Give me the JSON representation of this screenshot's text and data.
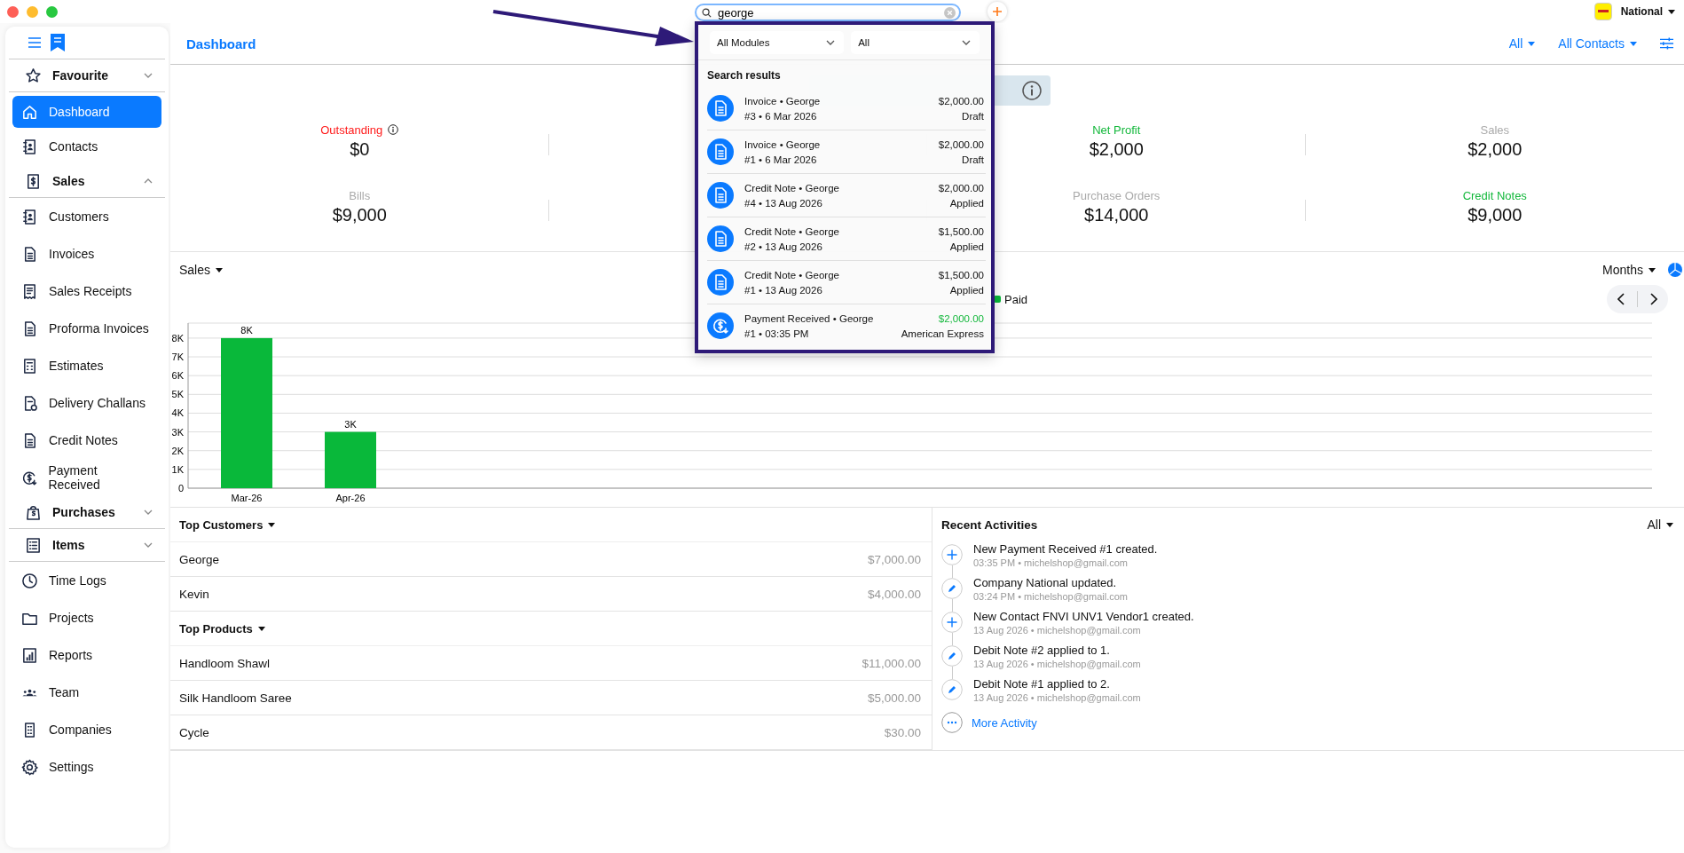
{
  "search": {
    "value": "george"
  },
  "company": {
    "name": "National"
  },
  "sidebar": {
    "items": [
      {
        "kind": "section",
        "label": "Favourite",
        "expanded": false
      },
      {
        "kind": "link",
        "label": "Dashboard",
        "selected": true
      },
      {
        "kind": "link",
        "label": "Contacts",
        "selected": false
      },
      {
        "kind": "section",
        "label": "Sales",
        "expanded": true
      },
      {
        "kind": "link",
        "label": "Customers",
        "selected": false
      },
      {
        "kind": "link",
        "label": "Invoices",
        "selected": false
      },
      {
        "kind": "link",
        "label": "Sales Receipts",
        "selected": false
      },
      {
        "kind": "link",
        "label": "Proforma Invoices",
        "selected": false
      },
      {
        "kind": "link",
        "label": "Estimates",
        "selected": false
      },
      {
        "kind": "link",
        "label": "Delivery Challans",
        "selected": false
      },
      {
        "kind": "link",
        "label": "Credit Notes",
        "selected": false
      },
      {
        "kind": "link",
        "label": "Payment Received",
        "selected": false
      },
      {
        "kind": "section",
        "label": "Purchases",
        "expanded": false
      },
      {
        "kind": "section",
        "label": "Items",
        "expanded": false
      },
      {
        "kind": "link",
        "label": "Time Logs",
        "selected": false
      },
      {
        "kind": "link",
        "label": "Projects",
        "selected": false
      },
      {
        "kind": "link",
        "label": "Reports",
        "selected": false
      },
      {
        "kind": "link",
        "label": "Team",
        "selected": false
      },
      {
        "kind": "link",
        "label": "Companies",
        "selected": false
      },
      {
        "kind": "link",
        "label": "Settings",
        "selected": false
      }
    ]
  },
  "header": {
    "title": "Dashboard",
    "filters": [
      "All",
      "All Contacts"
    ]
  },
  "stats": [
    {
      "label": "Outstanding",
      "value": "$0",
      "color": "#ff1a1a",
      "info": true
    },
    {
      "label": "Net Profit",
      "value": "$2,000",
      "color": "#14b83c"
    },
    {
      "label": "Sales",
      "value": "$2,000",
      "color": "#aaaaaa"
    },
    {
      "label": "Bills",
      "value": "$9,000",
      "color": "#aaaaaa"
    },
    {
      "label": "Purchase Orders",
      "value": "$14,000",
      "color": "#aaaaaa"
    },
    {
      "label": "Credit Notes",
      "value": "$9,000",
      "color": "#14b83c"
    }
  ],
  "sales_chart": {
    "title": "Sales",
    "period": "Months",
    "chart_data": {
      "type": "bar",
      "grid": true,
      "categories": [
        "Mar-26",
        "Apr-26"
      ],
      "series": [
        {
          "name": "Paid",
          "color": "#09b83a",
          "values": [
            8000,
            3000
          ]
        }
      ],
      "ylim": [
        0,
        8800
      ],
      "yticks": [
        {
          "value": 0,
          "label": "0"
        },
        {
          "value": 1000,
          "label": "1K"
        },
        {
          "value": 2000,
          "label": "2K"
        },
        {
          "value": 3000,
          "label": "3K"
        },
        {
          "value": 4000,
          "label": "4K"
        },
        {
          "value": 5000,
          "label": "5K"
        },
        {
          "value": 6000,
          "label": "6K"
        },
        {
          "value": 7000,
          "label": "7K"
        },
        {
          "value": 8000,
          "label": "8K"
        }
      ],
      "value_labels": [
        "8K",
        "3K"
      ]
    }
  },
  "top_customers": {
    "title": "Top Customers",
    "rows": [
      {
        "name": "George",
        "amount": "$7,000.00"
      },
      {
        "name": "Kevin",
        "amount": "$4,000.00"
      }
    ]
  },
  "top_products": {
    "title": "Top Products",
    "rows": [
      {
        "name": "Handloom Shawl",
        "amount": "$11,000.00"
      },
      {
        "name": "Silk Handloom Saree",
        "amount": "$5,000.00"
      },
      {
        "name": "Cycle",
        "amount": "$30.00"
      }
    ]
  },
  "recent_activities": {
    "title": "Recent Activities",
    "filter": "All",
    "more": "More Activity",
    "items": [
      {
        "kind": "create",
        "text": "New Payment Received #1 created.",
        "meta": "03:35 PM • michelshop@gmail.com"
      },
      {
        "kind": "edit",
        "text": "Company National updated.",
        "meta": "03:24 PM • michelshop@gmail.com"
      },
      {
        "kind": "create",
        "text": "New Contact FNVI UNV1 Vendor1 created.",
        "meta": "13 Aug 2026 • michelshop@gmail.com"
      },
      {
        "kind": "edit",
        "text": "Debit Note #2 applied to 1.",
        "meta": "13 Aug 2026 • michelshop@gmail.com"
      },
      {
        "kind": "edit",
        "text": "Debit Note #1 applied to 2.",
        "meta": "13 Aug 2026 • michelshop@gmail.com"
      }
    ]
  },
  "search_results": {
    "filters": [
      "All Modules",
      "All"
    ],
    "heading": "Search results",
    "results": [
      {
        "kind": "invoice",
        "title": "Invoice • George",
        "subtitle": "#3 • 6 Mar 2026",
        "amount": "$2,000.00",
        "status": "Draft"
      },
      {
        "kind": "invoice",
        "title": "Invoice • George",
        "subtitle": "#1 • 6 Mar 2026",
        "amount": "$2,000.00",
        "status": "Draft"
      },
      {
        "kind": "credit",
        "title": "Credit Note • George",
        "subtitle": "#4 • 13 Aug 2026",
        "amount": "$2,000.00",
        "status": "Applied"
      },
      {
        "kind": "credit",
        "title": "Credit Note • George",
        "subtitle": "#2 • 13 Aug 2026",
        "amount": "$1,500.00",
        "status": "Applied"
      },
      {
        "kind": "credit",
        "title": "Credit Note • George",
        "subtitle": "#1 • 13 Aug 2026",
        "amount": "$1,500.00",
        "status": "Applied"
      },
      {
        "kind": "payment",
        "title": "Payment Received • George",
        "subtitle": "#1 • 03:35 PM",
        "amount": "$2,000.00",
        "status": "American Express"
      }
    ]
  }
}
